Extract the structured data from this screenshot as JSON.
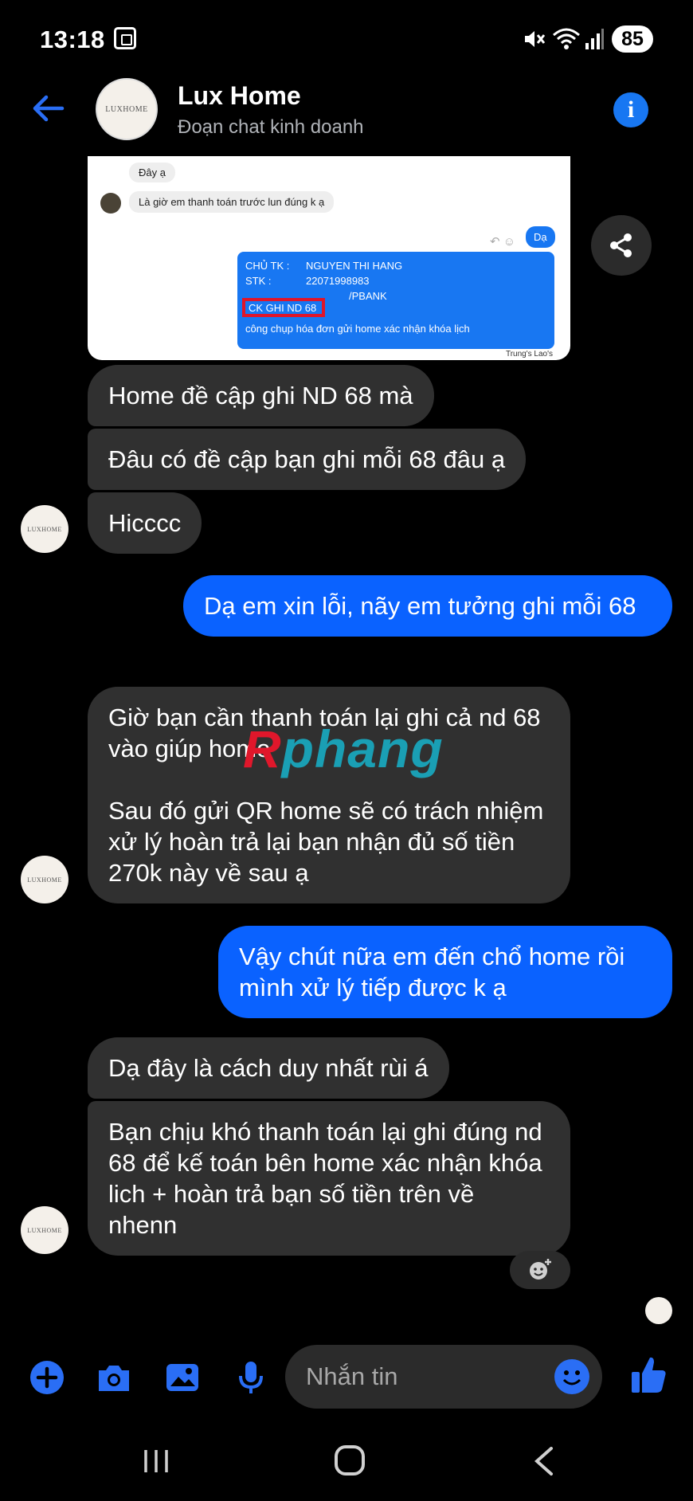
{
  "status": {
    "time": "13:18",
    "battery": "85"
  },
  "header": {
    "title": "Lux Home",
    "subtitle": "Đoạn chat kinh doanh",
    "avatar_text": "LUXHOME"
  },
  "shared_image": {
    "msg1": "Đây ạ",
    "msg2": "Là giờ em thanh toán trước lun đúng k ạ",
    "reply": "Dạ",
    "owner_label": "CHỦ TK :",
    "owner_value": "NGUYEN THI HANG",
    "stk_label": "STK :",
    "stk_value": "22071998983",
    "bank_value": "/PBANK",
    "ck_note": "CK GHI ND 68",
    "note": "công chụp hóa đơn gửi home xác nhận khóa lịch",
    "watermark": "Trung's Lao's"
  },
  "messages": {
    "m1": "Home đề cập ghi ND 68 mà",
    "m2": "Đâu có đề cập bạn ghi mỗi 68 đâu ạ",
    "m3": "Hicccc",
    "m4": "Dạ em xin lỗi, nãy em tưởng ghi mỗi 68",
    "m5a": "Giờ bạn cần thanh toán lại ghi cả nd 68 vào giúp home",
    "m5b": "Sau đó gửi QR home sẽ có trách nhiệm xử lý hoàn trả lại bạn nhận đủ số tiền 270k này về sau ạ",
    "m6": "Vậy chút nữa em đến chổ home rồi mình xử lý tiếp được k ạ",
    "m7": "Dạ đây là cách duy nhất rùi á",
    "m8": "Bạn chịu khó thanh toán lại ghi đúng nd 68 để kế toán bên home xác nhận khóa lich + hoàn trả bạn số tiền trên về nhenn"
  },
  "watermark": {
    "part1": "R",
    "part2": "phang"
  },
  "composer": {
    "placeholder": "Nhắn tin"
  },
  "colors": {
    "accent": "#0a62ff",
    "incoming": "#303030"
  }
}
